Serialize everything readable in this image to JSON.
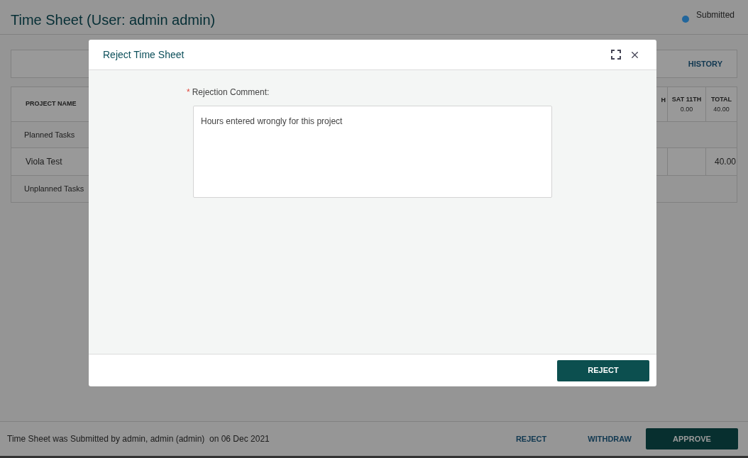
{
  "header": {
    "title": "Time Sheet (User: admin admin)",
    "status": {
      "label": "Submitted",
      "color": "#22669c"
    }
  },
  "toolbar": {
    "history": "HISTORY"
  },
  "table": {
    "columns": [
      "PROJECT NAME",
      "H",
      {
        "day": "SAT 11TH",
        "hours": "0.00"
      },
      {
        "day": "TOTAL",
        "hours": "40.00"
      }
    ],
    "rows": [
      {
        "kind": "group",
        "name": "Planned Tasks"
      },
      {
        "kind": "project",
        "name": "Viola Test",
        "total": "40.00"
      },
      {
        "kind": "group",
        "name": "Unplanned Tasks"
      }
    ]
  },
  "footer": {
    "message": "Time Sheet was Submitted by admin, admin (admin)  on 06 Dec 2021",
    "buttons": [
      "REJECT",
      "WITHDRAW",
      "APPROVE"
    ]
  },
  "dialog": {
    "title": "Reject Time Sheet",
    "field": {
      "label": "Rejection Comment:",
      "required_mark": "*",
      "value": "Hours entered wrongly for this project"
    },
    "button": "REJECT"
  }
}
